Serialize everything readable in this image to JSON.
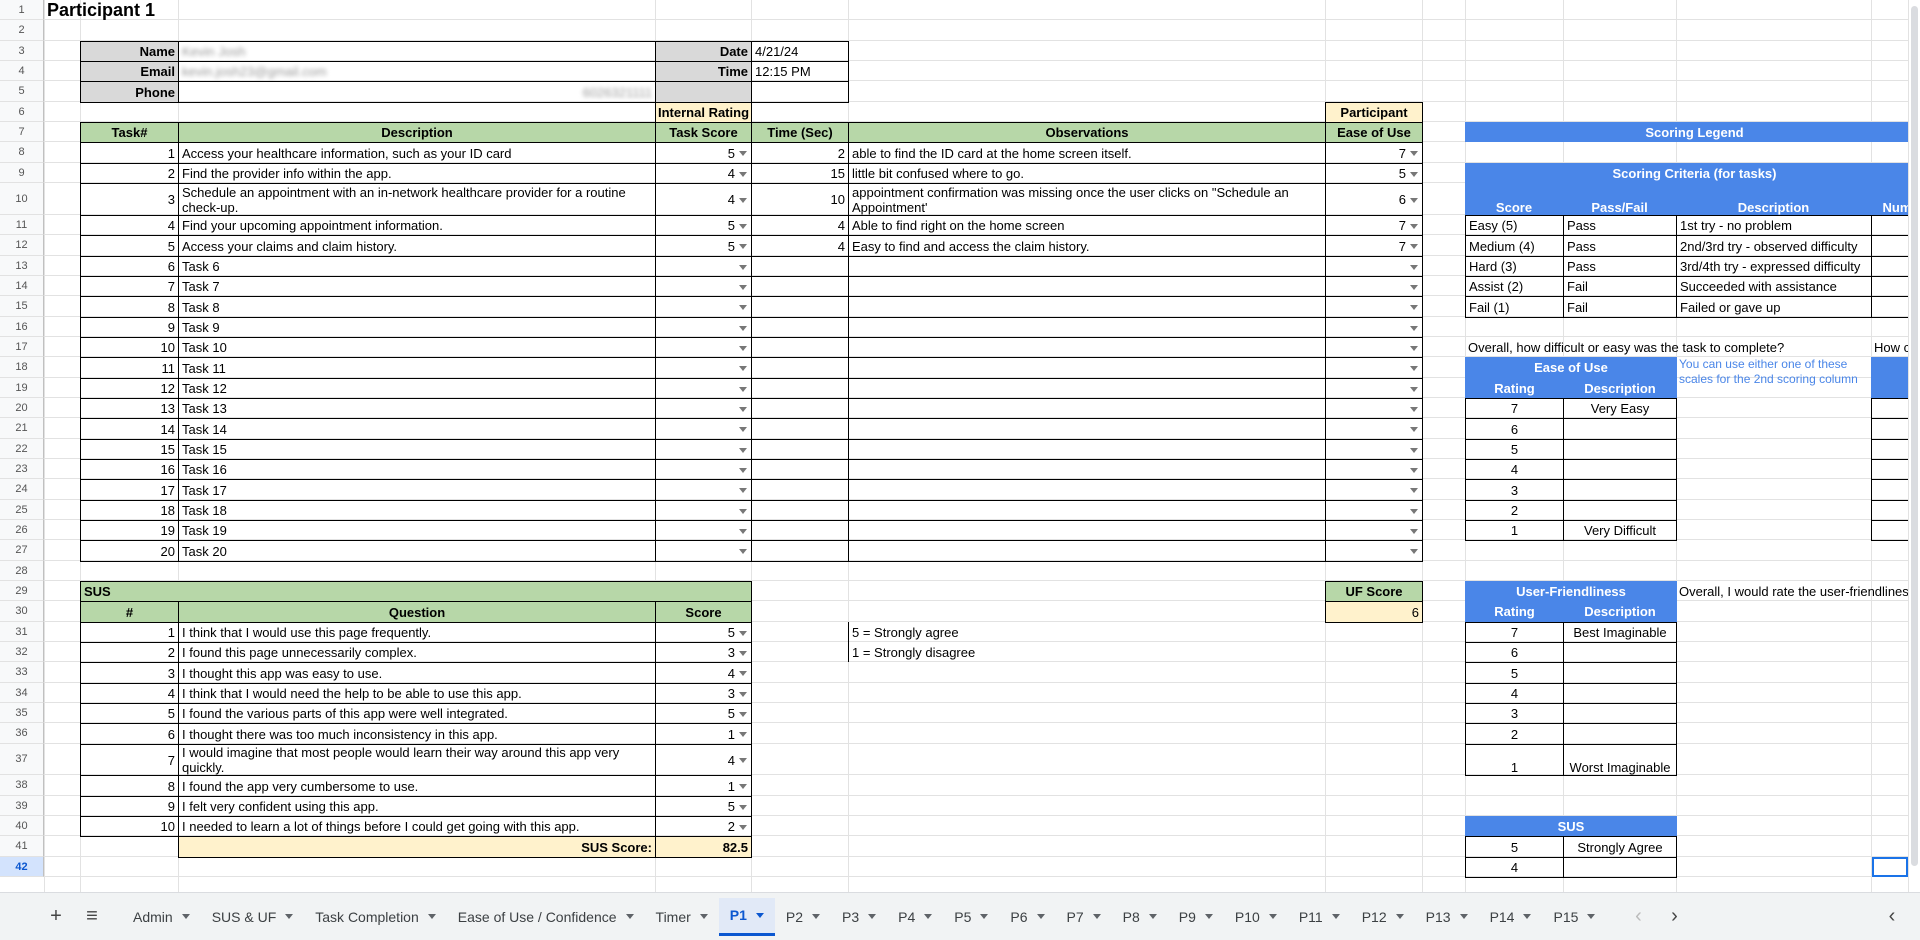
{
  "title": "Participant 1",
  "info": {
    "name_label": "Name",
    "name_value": "Kevin Josh",
    "email_label": "Email",
    "email_value": "kevin.josh23@gmail.com",
    "phone_label": "Phone",
    "phone_value": "6026321111",
    "date_label": "Date",
    "date_value": "4/21/24",
    "time_label": "Time",
    "time_value": "12:15 PM"
  },
  "tasks_table": {
    "internal_rating_label": "Internal Rating",
    "participant_label": "Participant",
    "headers": [
      "Task#",
      "Description",
      "Task Score",
      "Time (Sec)",
      "Observations",
      "Ease of Use"
    ],
    "rows": [
      {
        "num": "1",
        "desc": "Access your healthcare information, such as your ID card",
        "score": "5",
        "time": "2",
        "obs": "able to find the ID card at the home screen itself.",
        "ease": "7"
      },
      {
        "num": "2",
        "desc": "Find the provider info within the app.",
        "score": "4",
        "time": "15",
        "obs": "little bit confused where to go.",
        "ease": "5"
      },
      {
        "num": "3",
        "desc": "Schedule an appointment with an in-network healthcare provider for a routine check-up.",
        "score": "4",
        "time": "10",
        "obs": "appointment confirmation was missing once the user clicks on \"Schedule an Appointment'",
        "ease": "6"
      },
      {
        "num": "4",
        "desc": "Find your upcoming appointment information.",
        "score": "5",
        "time": "4",
        "obs": "Able to find right on the home screen",
        "ease": "7"
      },
      {
        "num": "5",
        "desc": "Access your claims and claim history.",
        "score": "5",
        "time": "4",
        "obs": "Easy to find and access the claim history.",
        "ease": "7"
      },
      {
        "num": "6",
        "desc": "Task 6",
        "score": "",
        "time": "",
        "obs": "",
        "ease": ""
      },
      {
        "num": "7",
        "desc": "Task 7",
        "score": "",
        "time": "",
        "obs": "",
        "ease": ""
      },
      {
        "num": "8",
        "desc": "Task 8",
        "score": "",
        "time": "",
        "obs": "",
        "ease": ""
      },
      {
        "num": "9",
        "desc": "Task 9",
        "score": "",
        "time": "",
        "obs": "",
        "ease": ""
      },
      {
        "num": "10",
        "desc": "Task 10",
        "score": "",
        "time": "",
        "obs": "",
        "ease": ""
      },
      {
        "num": "11",
        "desc": "Task 11",
        "score": "",
        "time": "",
        "obs": "",
        "ease": ""
      },
      {
        "num": "12",
        "desc": "Task 12",
        "score": "",
        "time": "",
        "obs": "",
        "ease": ""
      },
      {
        "num": "13",
        "desc": "Task 13",
        "score": "",
        "time": "",
        "obs": "",
        "ease": ""
      },
      {
        "num": "14",
        "desc": "Task 14",
        "score": "",
        "time": "",
        "obs": "",
        "ease": ""
      },
      {
        "num": "15",
        "desc": "Task 15",
        "score": "",
        "time": "",
        "obs": "",
        "ease": ""
      },
      {
        "num": "16",
        "desc": "Task 16",
        "score": "",
        "time": "",
        "obs": "",
        "ease": ""
      },
      {
        "num": "17",
        "desc": "Task 17",
        "score": "",
        "time": "",
        "obs": "",
        "ease": ""
      },
      {
        "num": "18",
        "desc": "Task 18",
        "score": "",
        "time": "",
        "obs": "",
        "ease": ""
      },
      {
        "num": "19",
        "desc": "Task 19",
        "score": "",
        "time": "",
        "obs": "",
        "ease": ""
      },
      {
        "num": "20",
        "desc": "Task 20",
        "score": "",
        "time": "",
        "obs": "",
        "ease": ""
      }
    ]
  },
  "sus": {
    "label": "SUS",
    "headers": [
      "#",
      "Question",
      "Score"
    ],
    "rows": [
      {
        "num": "1",
        "q": "I think that I would use this page frequently.",
        "score": "5"
      },
      {
        "num": "2",
        "q": "I found this page unnecessarily complex.",
        "score": "3"
      },
      {
        "num": "3",
        "q": "I thought this app was easy to use.",
        "score": "4"
      },
      {
        "num": "4",
        "q": "I think that I would need the help to be able to use this app.",
        "score": "3"
      },
      {
        "num": "5",
        "q": "I found the various parts of this app were well integrated.",
        "score": "5"
      },
      {
        "num": "6",
        "q": "I thought there was too much inconsistency in this app.",
        "score": "1"
      },
      {
        "num": "7",
        "q": "I would imagine that most people would learn their way around this app very quickly.",
        "score": "4"
      },
      {
        "num": "8",
        "q": "I found the app very cumbersome to use.",
        "score": "1"
      },
      {
        "num": "9",
        "q": "I felt very confident using this app.",
        "score": "5"
      },
      {
        "num": "10",
        "q": "I needed to learn a lot of things before I could get going with this app.",
        "score": "2"
      }
    ],
    "score_label": "SUS Score:",
    "score_value": "82.5",
    "note_agree": "5 = Strongly agree",
    "note_disagree": "1 = Strongly disagree"
  },
  "uf": {
    "label": "UF Score",
    "value": "6"
  },
  "legend": {
    "title": "Scoring Legend",
    "criteria_title": "Scoring Criteria (for tasks)",
    "criteria_headers": [
      "Score",
      "Pass/Fail",
      "Description",
      "Num"
    ],
    "criteria_rows": [
      {
        "score": "Easy (5)",
        "pf": "Pass",
        "desc": "1st try - no problem"
      },
      {
        "score": "Medium (4)",
        "pf": "Pass",
        "desc": "2nd/3rd try - observed difficulty"
      },
      {
        "score": "Hard (3)",
        "pf": "Pass",
        "desc": "3rd/4th try - expressed difficulty"
      },
      {
        "score": "Assist (2)",
        "pf": "Fail",
        "desc": "Succeeded with assistance"
      },
      {
        "score": "Fail (1)",
        "pf": "Fail",
        "desc": "Failed or gave up"
      }
    ],
    "ease_question": "Overall, how difficult or easy was the task to complete?",
    "ease_question2": "How c",
    "ease_title": "Ease of Use",
    "ease_note": "You can use either one of these scales for the 2nd scoring column",
    "rating_label": "Rating",
    "description_label": "Description",
    "ease_rows": [
      {
        "r": "7",
        "d": "Very Easy"
      },
      {
        "r": "6",
        "d": ""
      },
      {
        "r": "5",
        "d": ""
      },
      {
        "r": "4",
        "d": ""
      },
      {
        "r": "3",
        "d": ""
      },
      {
        "r": "2",
        "d": ""
      },
      {
        "r": "1",
        "d": "Very Difficult"
      }
    ],
    "uf_title": "User-Friendliness",
    "uf_question": "Overall, I would rate the user-friendliness",
    "uf_rows": [
      {
        "r": "7",
        "d": "Best Imaginable"
      },
      {
        "r": "6",
        "d": ""
      },
      {
        "r": "5",
        "d": ""
      },
      {
        "r": "4",
        "d": ""
      },
      {
        "r": "3",
        "d": ""
      },
      {
        "r": "2",
        "d": ""
      },
      {
        "r": "1",
        "d": "Worst Imaginable"
      }
    ],
    "sus_title": "SUS",
    "sus_rows": [
      {
        "r": "5",
        "d": "Strongly Agree"
      },
      {
        "r": "4",
        "d": ""
      }
    ]
  },
  "tabs": [
    {
      "label": "Admin",
      "active": false
    },
    {
      "label": "SUS & UF",
      "active": false
    },
    {
      "label": "Task Completion",
      "active": false
    },
    {
      "label": "Ease of Use / Confidence",
      "active": false
    },
    {
      "label": "Timer",
      "active": false
    },
    {
      "label": "P1",
      "active": true
    },
    {
      "label": "P2",
      "active": false
    },
    {
      "label": "P3",
      "active": false
    },
    {
      "label": "P4",
      "active": false
    },
    {
      "label": "P5",
      "active": false
    },
    {
      "label": "P6",
      "active": false
    },
    {
      "label": "P7",
      "active": false
    },
    {
      "label": "P8",
      "active": false
    },
    {
      "label": "P9",
      "active": false
    },
    {
      "label": "P10",
      "active": false
    },
    {
      "label": "P11",
      "active": false
    },
    {
      "label": "P12",
      "active": false
    },
    {
      "label": "P13",
      "active": false
    },
    {
      "label": "P14",
      "active": false
    },
    {
      "label": "P15",
      "active": false
    }
  ],
  "row_numbers": [
    "1",
    "2",
    "3",
    "4",
    "5",
    "6",
    "7",
    "8",
    "9",
    "10",
    "11",
    "12",
    "13",
    "14",
    "15",
    "16",
    "17",
    "18",
    "19",
    "20",
    "21",
    "22",
    "23",
    "24",
    "25",
    "26",
    "27",
    "28",
    "29",
    "30",
    "31",
    "32",
    "33",
    "34",
    "35",
    "36",
    "37",
    "38",
    "39",
    "40",
    "41",
    "42"
  ],
  "selected_row": "42",
  "icons": {
    "add_sheet": "plus-icon",
    "all_sheets": "menu-icon",
    "scroll_left": "chevron-left-icon",
    "scroll_right": "chevron-right-icon",
    "explore": "chevron-left-icon"
  }
}
